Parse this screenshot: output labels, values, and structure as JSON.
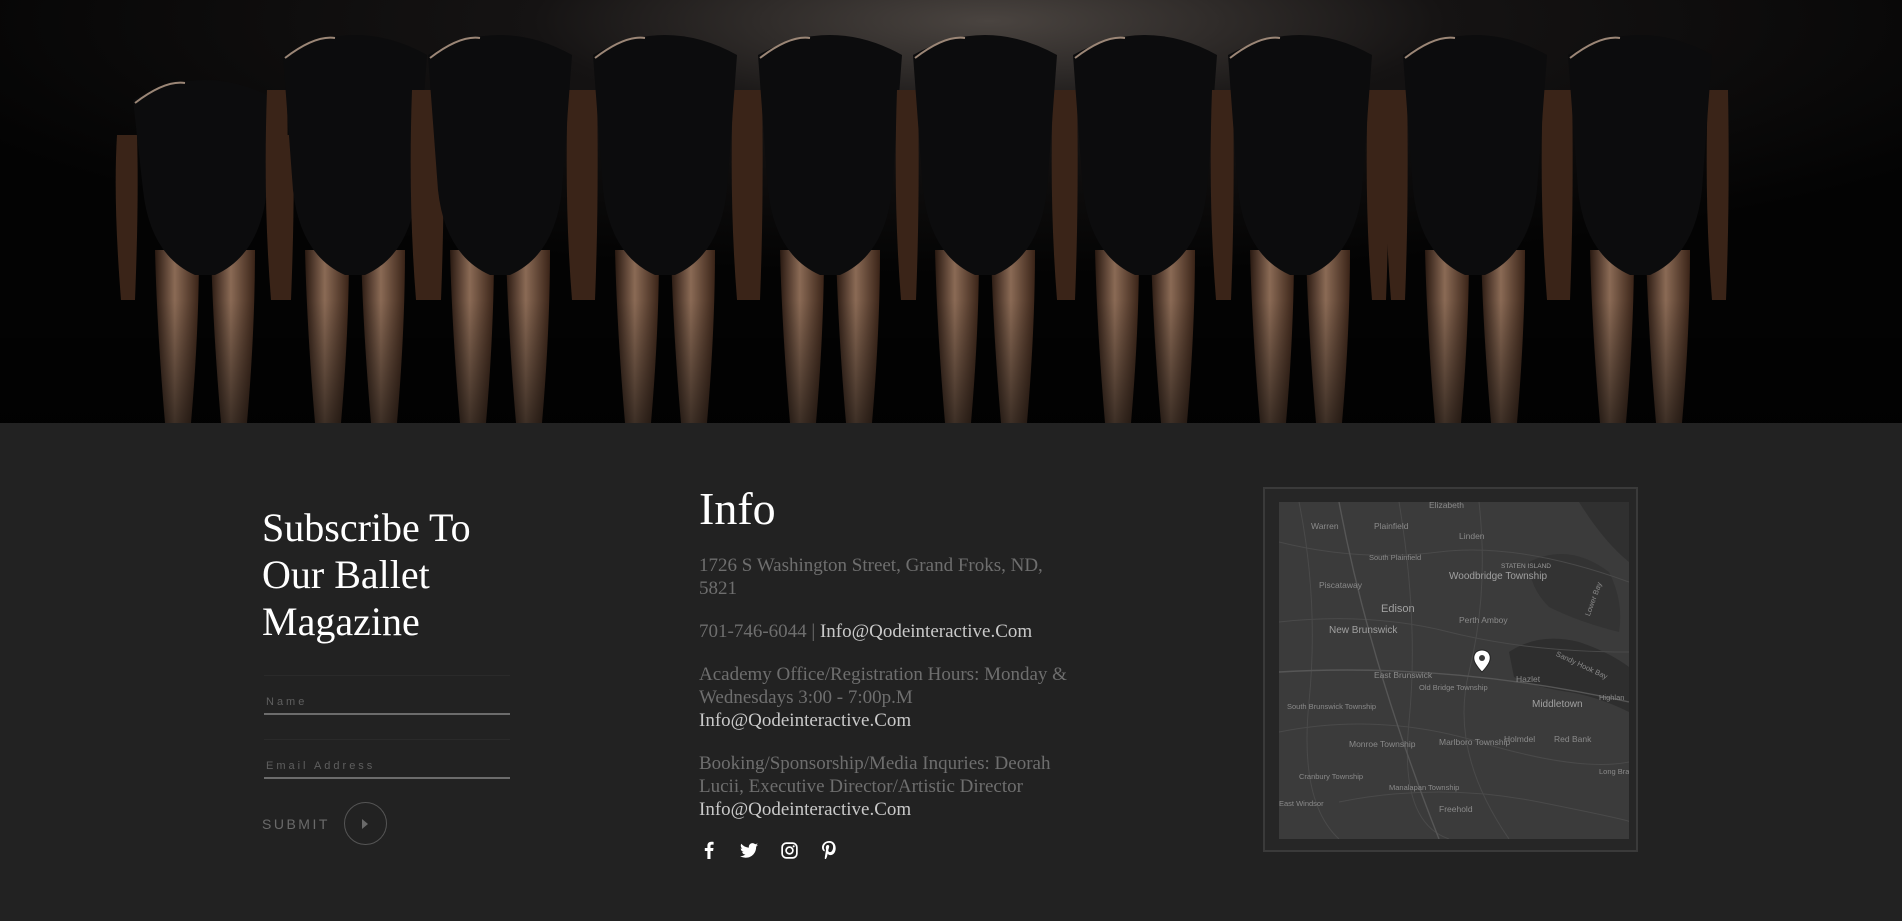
{
  "subscribe": {
    "title": "Subscribe To Our Ballet Magazine",
    "name_placeholder": "Name",
    "email_placeholder": "Email Address",
    "submit_label": "SUBMIT"
  },
  "info": {
    "title": "Info",
    "address": "1726 S Washington Street, Grand Froks, ND, 5821",
    "phone": "701-746-6044",
    "phone_sep": " | ",
    "email": "Info@Qodeinteractive.Com",
    "hours_text": "Academy Office/Registration Hours: Monday & Wednesdays 3:00 - 7:00p.M",
    "hours_email": "Info@Qodeinteractive.Com",
    "booking_text": "Booking/Sponsorship/Media Inquries: Deorah Lucii, Executive Director/Artistic Director",
    "booking_email": "Info@Qodeinteractive.Com"
  },
  "social": {
    "icons": [
      "facebook-icon",
      "twitter-icon",
      "instagram-icon",
      "pinterest-icon"
    ]
  },
  "map": {
    "labels": {
      "elizabeth": "Elizabeth",
      "warren": "Warren",
      "plainfield": "Plainfield",
      "linden": "Linden",
      "south_plainfield": "South Plainfield",
      "woodbridge": "Woodbridge Township",
      "staten_island": "STATEN ISLAND",
      "piscataway": "Piscataway",
      "edison": "Edison",
      "perth_amboy": "Perth Amboy",
      "lower_bay": "Lower Bay",
      "new_brunswick": "New Brunswick",
      "sandy_hook_bay": "Sandy Hook Bay",
      "east_brunswick": "East Brunswick",
      "old_bridge": "Old Bridge Township",
      "hazlet": "Hazlet",
      "middletown": "Middletown",
      "highlands": "Highlan",
      "south_brunswick": "South Brunswick Township",
      "monroe": "Monroe Township",
      "marlboro": "Marlboro Township",
      "holmdel": "Holmdel",
      "red_bank": "Red Bank",
      "cranbury": "Cranbury Township",
      "manalapan": "Manalapan Township",
      "long_branch": "Long Bra",
      "east_windsor": "East Windsor",
      "freehold": "Freehold"
    }
  },
  "colors": {
    "footer_bg": "#222222",
    "heading": "#ffffff",
    "muted_text": "#6e6e6e",
    "link_text": "#c9c9c9"
  }
}
